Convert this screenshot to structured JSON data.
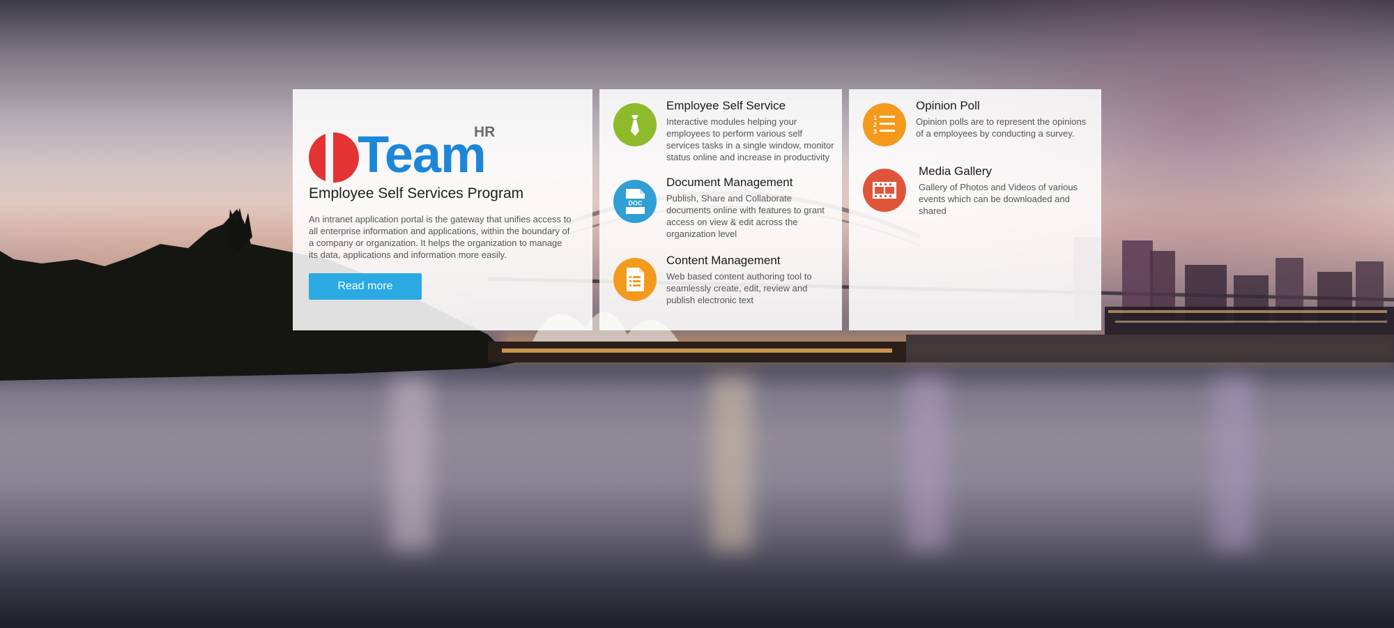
{
  "intro": {
    "logo_text": "Team",
    "logo_superscript": "HR",
    "title": "Employee Self Services Program",
    "body": "An intranet application portal is the gateway that unifies access to all enterprise information and applications, within the boundary of a company or organization. It helps the organization to manage its data, applications and information more easily.",
    "button_label": "Read more"
  },
  "features": [
    {
      "title": "Employee Self Service",
      "description": "Interactive modules helping  your employees to perform various self services tasks in a single window, monitor status online and increase in productivity",
      "icon": "tie-icon",
      "color": "#8dbb2b"
    },
    {
      "title": "Document Management",
      "description": "Publish, Share and Collaborate documents online with features to grant access on view & edit across the organization level",
      "icon": "doc-file-icon",
      "icon_label": "DOC",
      "color": "#2f9fd4"
    },
    {
      "title": "Content Management",
      "description": "Web based content authoring tool to seamlessly create, edit, review and publish electronic text",
      "icon": "document-list-icon",
      "color": "#f39a1d"
    },
    {
      "title": "Opinion Poll",
      "description": "Opinion polls are to represent the opinions of a employees by conducting a survey.",
      "icon": "numbered-list-icon",
      "color": "#f39a1d"
    },
    {
      "title": "Media Gallery",
      "description": "Gallery of Photos and Videos of various events which can be downloaded and shared",
      "icon": "film-icon",
      "color": "#e0553a"
    }
  ]
}
